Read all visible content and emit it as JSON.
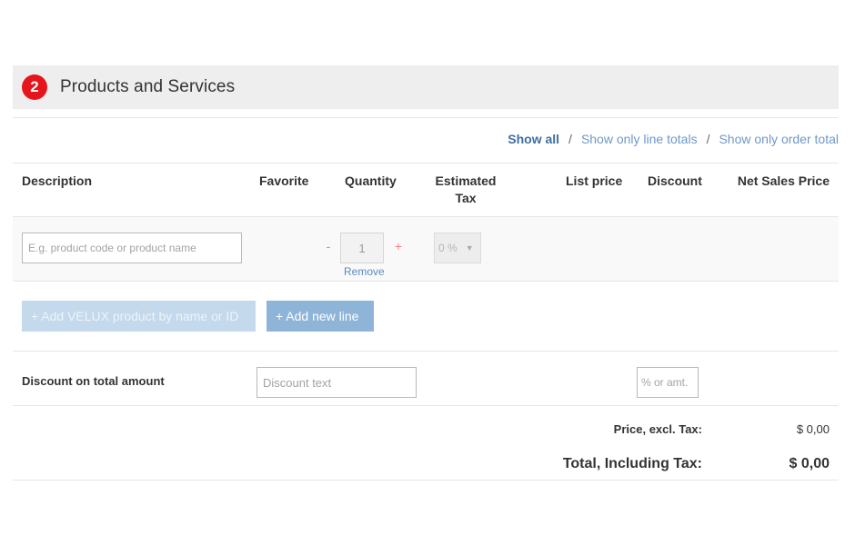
{
  "section": {
    "step_number": "2",
    "title": "Products and Services"
  },
  "view_toggle": {
    "show_all": "Show all",
    "separator": "/",
    "show_line_totals": "Show only line totals",
    "show_order_total": "Show only order total"
  },
  "table": {
    "headers": {
      "description": "Description",
      "favorite": "Favorite",
      "quantity": "Quantity",
      "estimated_tax_line1": "Estimated",
      "estimated_tax_line2": "Tax",
      "list_price": "List price",
      "discount": "Discount",
      "net_sales_price": "Net Sales Price"
    },
    "row": {
      "description_placeholder": "E.g. product code or product name",
      "qty_minus": "-",
      "qty_value": "1",
      "qty_plus": "+",
      "remove": "Remove",
      "tax_value": "0 %",
      "tax_caret": "▼"
    }
  },
  "buttons": {
    "add_velux": "+ Add VELUX product by name or ID",
    "add_new_line": "+ Add new line"
  },
  "discount": {
    "label": "Discount on total amount",
    "text_placeholder": "Discount text",
    "amount_placeholder": "% or amt."
  },
  "summary": {
    "price_excl_label": "Price, excl. Tax:",
    "price_excl_value": "$ 0,00",
    "total_incl_label": "Total, Including Tax:",
    "total_incl_value": "$ 0,00"
  },
  "colors": {
    "badge": "#e8141c",
    "link": "#6e98c8",
    "link_active": "#3d6f9f",
    "button_disabled": "#c4d9ec",
    "button": "#8eb4d8",
    "header_bg": "#eeeeee"
  }
}
